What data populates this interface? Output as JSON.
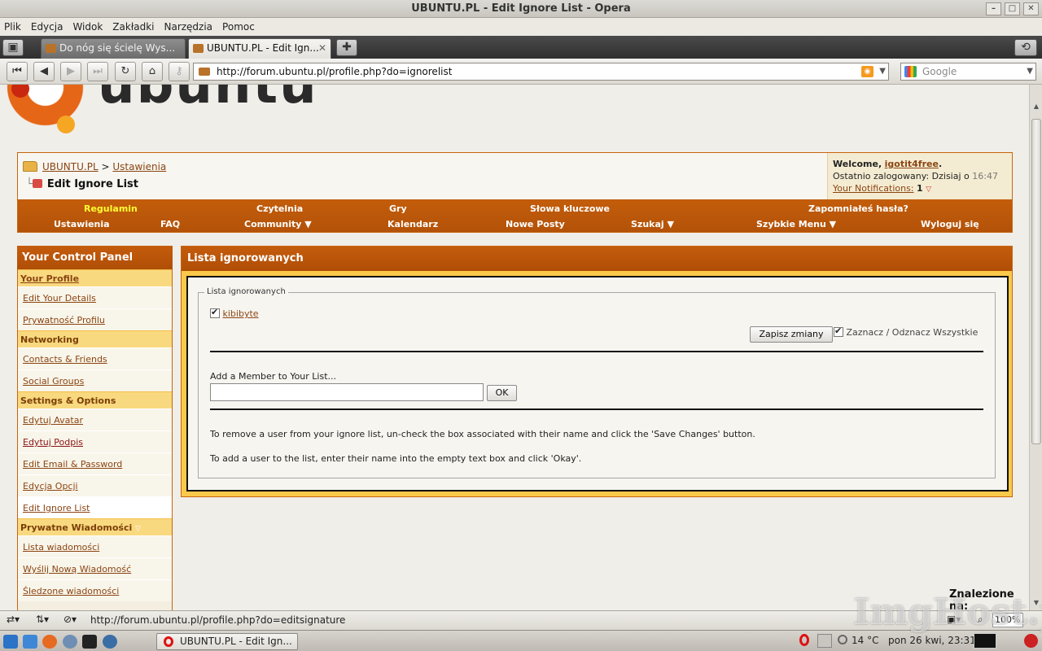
{
  "window": {
    "title": "UBUNTU.PL - Edit Ignore List - Opera"
  },
  "menu": [
    "Plik",
    "Edycja",
    "Widok",
    "Zakładki",
    "Narzędzia",
    "Pomoc"
  ],
  "tabs": [
    {
      "label": "Do nóg się ścielę Wys..."
    },
    {
      "label": "UBUNTU.PL - Edit Ign..."
    }
  ],
  "address": {
    "url": "http://forum.ubuntu.pl/profile.php?do=ignorelist"
  },
  "search": {
    "placeholder": "Google"
  },
  "site": {
    "logo_text": "ubuntu",
    "breadcrumb": {
      "home": "UBUNTU.PL",
      "sep": ">",
      "parent": "Ustawienia"
    },
    "page_title": "Edit Ignore List",
    "welcome": {
      "prefix": "Welcome,",
      "user": "igotit4free",
      "suffix": ".",
      "last_login_label": "Ostatnio zalogowany: Dzisiaj o",
      "last_login_time": "16:47",
      "notif_label": "Your Notifications:",
      "notif_count": "1"
    },
    "nav_row1": [
      "Regulamin",
      "Czytelnia",
      "Gry",
      "Słowa kluczowe",
      "Zapomniałeś hasła?"
    ],
    "nav_row2": [
      "Ustawienia",
      "FAQ",
      "Community",
      "Kalendarz",
      "Nowe Posty",
      "Szukaj",
      "Szybkie Menu",
      "Wyloguj się"
    ]
  },
  "sidebar": {
    "title": "Your Control Panel",
    "sections": [
      {
        "label": "Your Profile",
        "items": [
          "Edit Your Details",
          "Prywatność Profilu"
        ]
      },
      {
        "label": "Networking",
        "items": [
          "Contacts & Friends",
          "Social Groups"
        ]
      },
      {
        "label": "Settings & Options",
        "items": [
          "Edytuj Avatar",
          "Edytuj Podpis",
          "Edit Email & Password",
          "Edycja Opcji",
          "Edit Ignore List"
        ]
      },
      {
        "label": "Prywatne Wiadomości",
        "items": [
          "Lista wiadomości",
          "Wyślij Nową Wiadomość",
          "Śledzone wiadomości"
        ]
      }
    ]
  },
  "panel": {
    "title": "Lista ignorowanych",
    "legend": "Lista ignorowanych",
    "ignored_users": [
      "kibibyte"
    ],
    "save_label": "Zapisz zmiany",
    "select_all_label": "Zaznacz / Odznacz Wszystkie",
    "add_label": "Add a Member to Your List...",
    "add_value": "",
    "ok_label": "OK",
    "help1": "To remove a user from your ignore list, un-check the box associated with their name and click the 'Save Changes' button.",
    "help2": "To add a user to the list, enter their name into the empty text box and click 'Okay'."
  },
  "float_text": "Znalezione na:",
  "status": {
    "url": "http://forum.ubuntu.pl/profile.php?do=editsignature",
    "zoom": "100%"
  },
  "taskbar": {
    "window_label": "UBUNTU.PL - Edit Ign...",
    "weather": "14 °C",
    "clock": "pon 26 kwi, 23:31"
  },
  "watermark": "ImgHost.pl",
  "colors": {
    "accent": "#c45c0c",
    "panel_bg": "#fbc94a",
    "link": "#8b4513",
    "highlight": "#ffff33"
  }
}
